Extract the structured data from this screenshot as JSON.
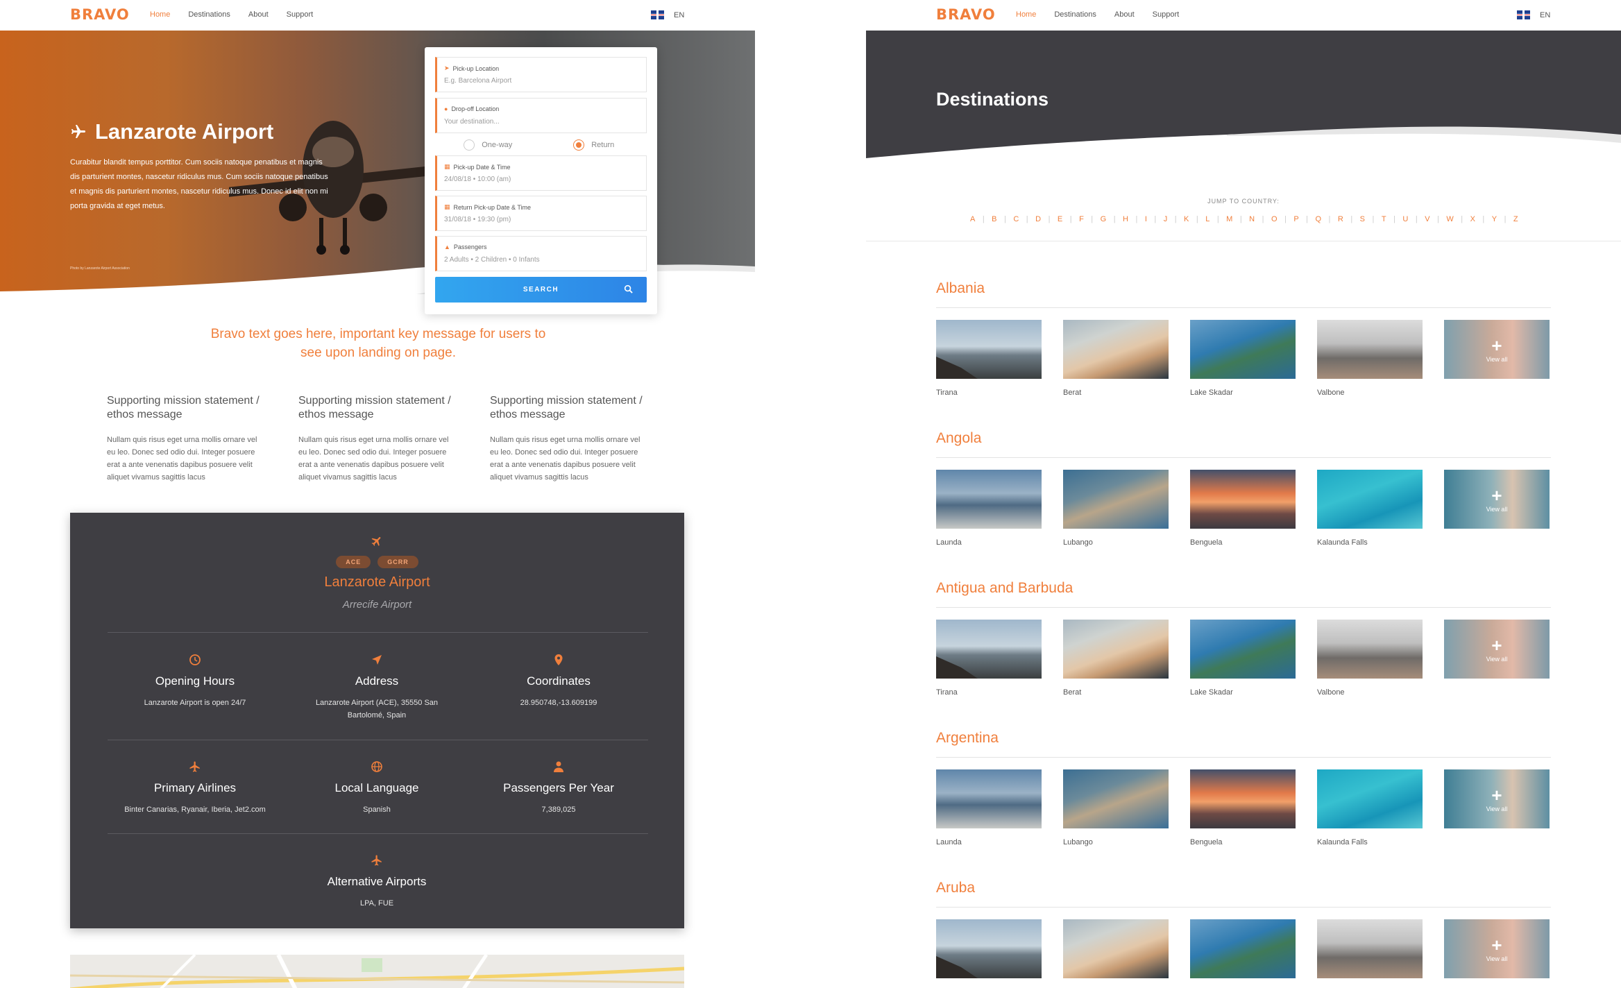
{
  "brand": "BRAVO",
  "nav": {
    "items": [
      "Home",
      "Destinations",
      "About",
      "Support"
    ],
    "active": "Home",
    "lang": "EN"
  },
  "colors": {
    "accent": "#f07f3c",
    "dark_panel": "#3f3e43",
    "button_blue": "#2d84e6"
  },
  "home": {
    "hero": {
      "title": "Lanzarote Airport",
      "body": "Curabitur blandit tempus porttitor. Cum sociis natoque penatibus et magnis dis parturient montes, nascetur ridiculus mus. Cum sociis natoque penatibus et magnis dis parturient montes, nascetur ridiculus mus. Donec id elit non mi porta gravida at eget metus.",
      "credit": "Photo by Lanzarote Airport Association"
    },
    "booking": {
      "pickup": {
        "label": "Pick-up Location",
        "placeholder": "E.g. Barcelona Airport"
      },
      "dropoff": {
        "label": "Drop-off Location",
        "placeholder": "Your destination..."
      },
      "trip_oneway": "One-way",
      "trip_return": "Return",
      "trip_selected": "Return",
      "pickup_date": {
        "label": "Pick-up Date & Time",
        "value": "24/08/18  •  10:00 (am)"
      },
      "return_date": {
        "label": "Return Pick-up Date & Time",
        "value": "31/08/18  •  19:30 (pm)"
      },
      "passengers": {
        "label": "Passengers",
        "value": "2 Adults  •  2 Children  •  0 Infants"
      },
      "search_label": "SEARCH"
    },
    "tagline": "Bravo text goes here, important key message for users to see upon landing on page.",
    "missions": [
      {
        "title": "Supporting mission statement / ethos message",
        "body": "Nullam quis risus eget urna mollis ornare vel eu leo. Donec sed odio dui. Integer posuere erat a ante venenatis dapibus posuere velit aliquet vivamus sagittis lacus"
      },
      {
        "title": "Supporting mission statement / ethos message",
        "body": "Nullam quis risus eget urna mollis ornare vel eu leo. Donec sed odio dui. Integer posuere erat a ante venenatis dapibus posuere velit aliquet vivamus sagittis lacus"
      },
      {
        "title": "Supporting mission statement / ethos message",
        "body": "Nullam quis risus eget urna mollis ornare vel eu leo. Donec sed odio dui. Integer posuere erat a ante venenatis dapibus posuere velit aliquet vivamus sagittis lacus"
      }
    ],
    "airport": {
      "codes": [
        "ACE",
        "GCRR"
      ],
      "name": "Lanzarote Airport",
      "alt_name": "Arrecife Airport",
      "opening": {
        "title": "Opening Hours",
        "value": "Lanzarote Airport is open 24/7",
        "icon": "clock-icon"
      },
      "address": {
        "title": "Address",
        "value": "Lanzarote Airport (ACE), 35550 San Bartolomé, Spain",
        "icon": "location-arrow-icon"
      },
      "coords": {
        "title": "Coordinates",
        "value": "28.950748,-13.609199",
        "icon": "map-pin-icon"
      },
      "airlines": {
        "title": "Primary Airlines",
        "value": "Binter Canarias, Ryanair, Iberia, Jet2.com",
        "icon": "plane-icon"
      },
      "language": {
        "title": "Local Language",
        "value": "Spanish",
        "icon": "globe-icon"
      },
      "passengers": {
        "title": "Passengers Per Year",
        "value": "7,389,025",
        "icon": "person-icon"
      },
      "alternative": {
        "title": "Alternative Airports",
        "value": "LPA, FUE",
        "icon": "plane-icon"
      }
    }
  },
  "destinations": {
    "title": "Destinations",
    "jump_label": "JUMP TO COUNTRY:",
    "letters": [
      "A",
      "B",
      "C",
      "D",
      "E",
      "F",
      "G",
      "H",
      "I",
      "J",
      "K",
      "L",
      "M",
      "N",
      "O",
      "P",
      "Q",
      "R",
      "S",
      "T",
      "U",
      "V",
      "W",
      "X",
      "Y",
      "Z"
    ],
    "view_all": "View all",
    "countries": [
      {
        "name": "Albania",
        "places": [
          "Tirana",
          "Berat",
          "Lake Skadar",
          "Valbone"
        ]
      },
      {
        "name": "Angola",
        "places": [
          "Launda",
          "Lubango",
          "Benguela",
          "Kalaunda Falls"
        ]
      },
      {
        "name": "Antigua and Barbuda",
        "places": [
          "Tirana",
          "Berat",
          "Lake Skadar",
          "Valbone"
        ]
      },
      {
        "name": "Argentina",
        "places": [
          "Launda",
          "Lubango",
          "Benguela",
          "Kalaunda Falls"
        ]
      },
      {
        "name": "Aruba",
        "places": [
          "Tirana",
          "Berat",
          "Lake Skadar",
          "Valbone"
        ]
      }
    ]
  }
}
